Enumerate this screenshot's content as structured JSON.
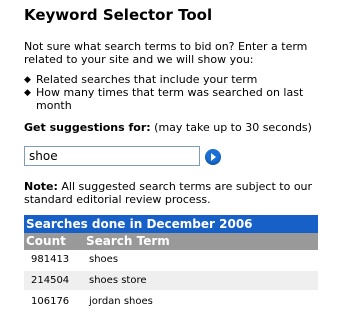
{
  "title": "Keyword Selector Tool",
  "intro": "Not sure what search terms to bid on? Enter a term related to your site and we will show you:",
  "bullets": [
    "Related searches that include your term",
    "How many times that term was searched on last month"
  ],
  "suggestions": {
    "label": "Get suggestions for:",
    "hint": "(may take up to 30 seconds)",
    "input_value": "shoe"
  },
  "note": {
    "label": "Note:",
    "text": "All suggested search terms are subject to our standard editorial review process."
  },
  "results": {
    "heading": "Searches done in December 2006",
    "columns": {
      "count": "Count",
      "term": "Search Term"
    },
    "rows": [
      {
        "count": "981413",
        "term": "shoes"
      },
      {
        "count": "214504",
        "term": "shoes store"
      },
      {
        "count": "106176",
        "term": "jordan shoes"
      }
    ]
  },
  "icons": {
    "go": "go-arrow-icon",
    "bullet": "diamond-bullet-icon"
  },
  "colors": {
    "header_blue": "#1760c8",
    "column_gray": "#999999",
    "go_button": "#1a6fd6"
  }
}
